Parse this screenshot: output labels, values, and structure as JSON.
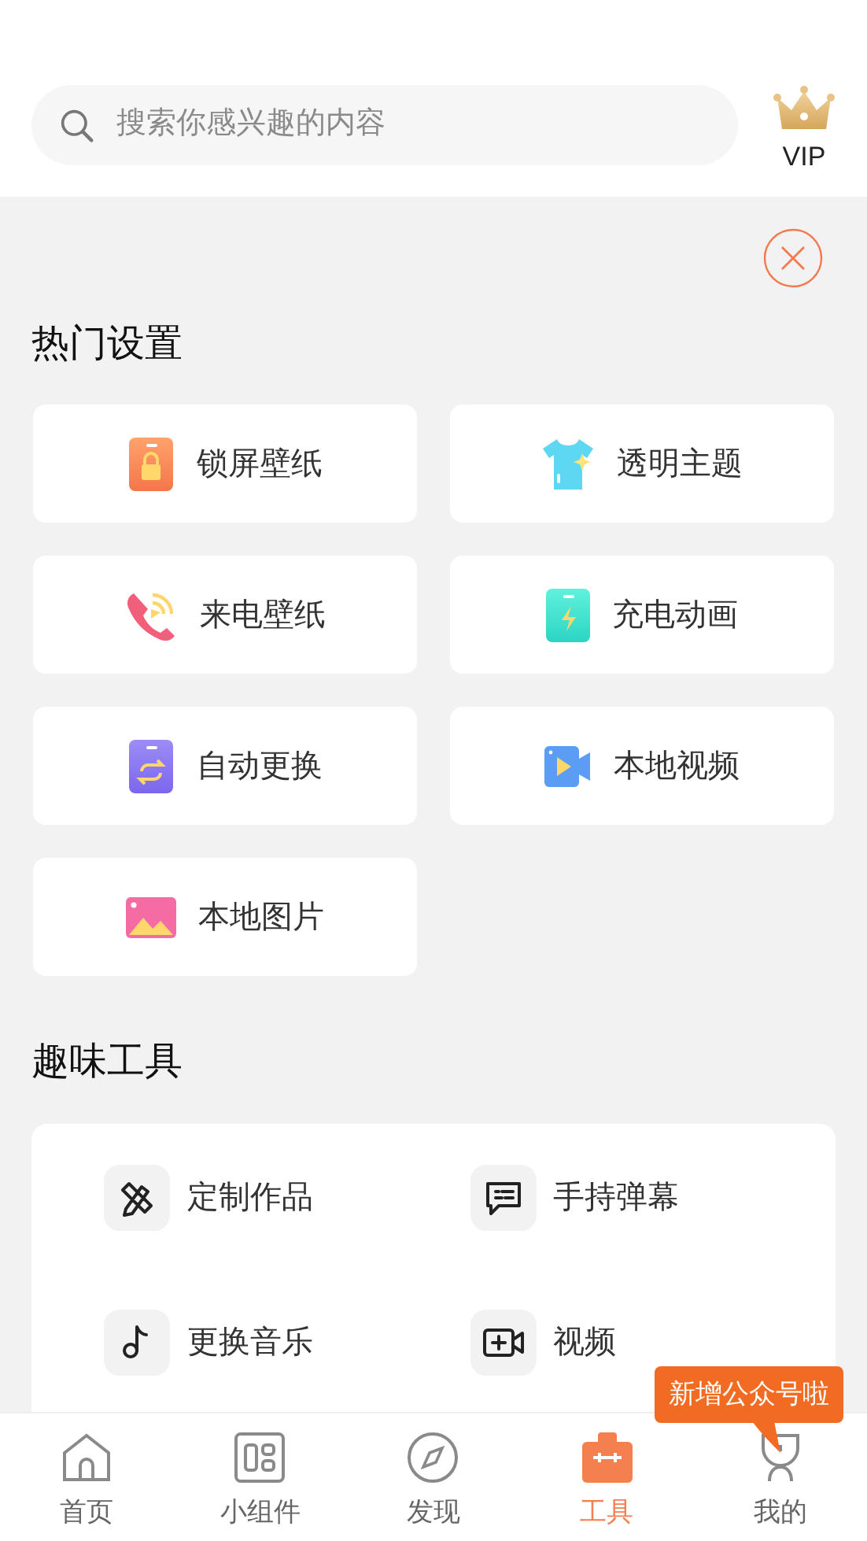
{
  "search": {
    "placeholder": "搜索你感兴趣的内容"
  },
  "vip": {
    "label": "VIP"
  },
  "hot_settings": {
    "title": "热门设置",
    "items": [
      {
        "label": "锁屏壁纸",
        "kind": "lock"
      },
      {
        "label": "透明主题",
        "kind": "shirt"
      },
      {
        "label": "来电壁纸",
        "kind": "call"
      },
      {
        "label": "充电动画",
        "kind": "charge"
      },
      {
        "label": "自动更换",
        "kind": "switch"
      },
      {
        "label": "本地视频",
        "kind": "video"
      },
      {
        "label": "本地图片",
        "kind": "image"
      }
    ]
  },
  "fun_tools": {
    "title": "趣味工具",
    "items": [
      {
        "label": "定制作品",
        "kind": "pencil"
      },
      {
        "label": "手持弹幕",
        "kind": "chat"
      },
      {
        "label": "更换音乐",
        "kind": "music"
      },
      {
        "label": "视频",
        "kind": "videoplus"
      }
    ]
  },
  "tooltip": {
    "text": "新增公众号啦"
  },
  "tab_bar": [
    {
      "label": "首页",
      "kind": "home",
      "selected": false
    },
    {
      "label": "小组件",
      "kind": "widget",
      "selected": false
    },
    {
      "label": "发现",
      "kind": "compass",
      "selected": false
    },
    {
      "label": "工具",
      "kind": "toolbox",
      "selected": true
    },
    {
      "label": "我的",
      "kind": "person",
      "selected": false
    }
  ]
}
